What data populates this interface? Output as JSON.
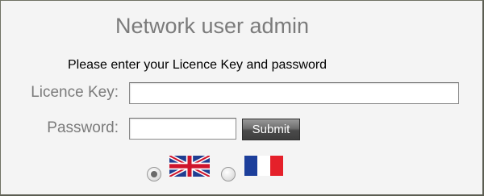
{
  "header": {
    "title": "Network user admin"
  },
  "form": {
    "instructions": "Please enter your Licence Key and password",
    "licence_key_label": "Licence Key:",
    "licence_key_value": "",
    "password_label": "Password:",
    "password_value": "",
    "submit_label": "Submit"
  },
  "languages": {
    "selected": "en",
    "options": [
      {
        "code": "en",
        "icon": "uk-flag-icon",
        "selected": true
      },
      {
        "code": "fr",
        "icon": "france-flag-icon",
        "selected": false
      }
    ]
  },
  "colors": {
    "title_text": "#7b7b7b",
    "background": "#f4f4f4",
    "button_dark": "#3e3e3e"
  }
}
